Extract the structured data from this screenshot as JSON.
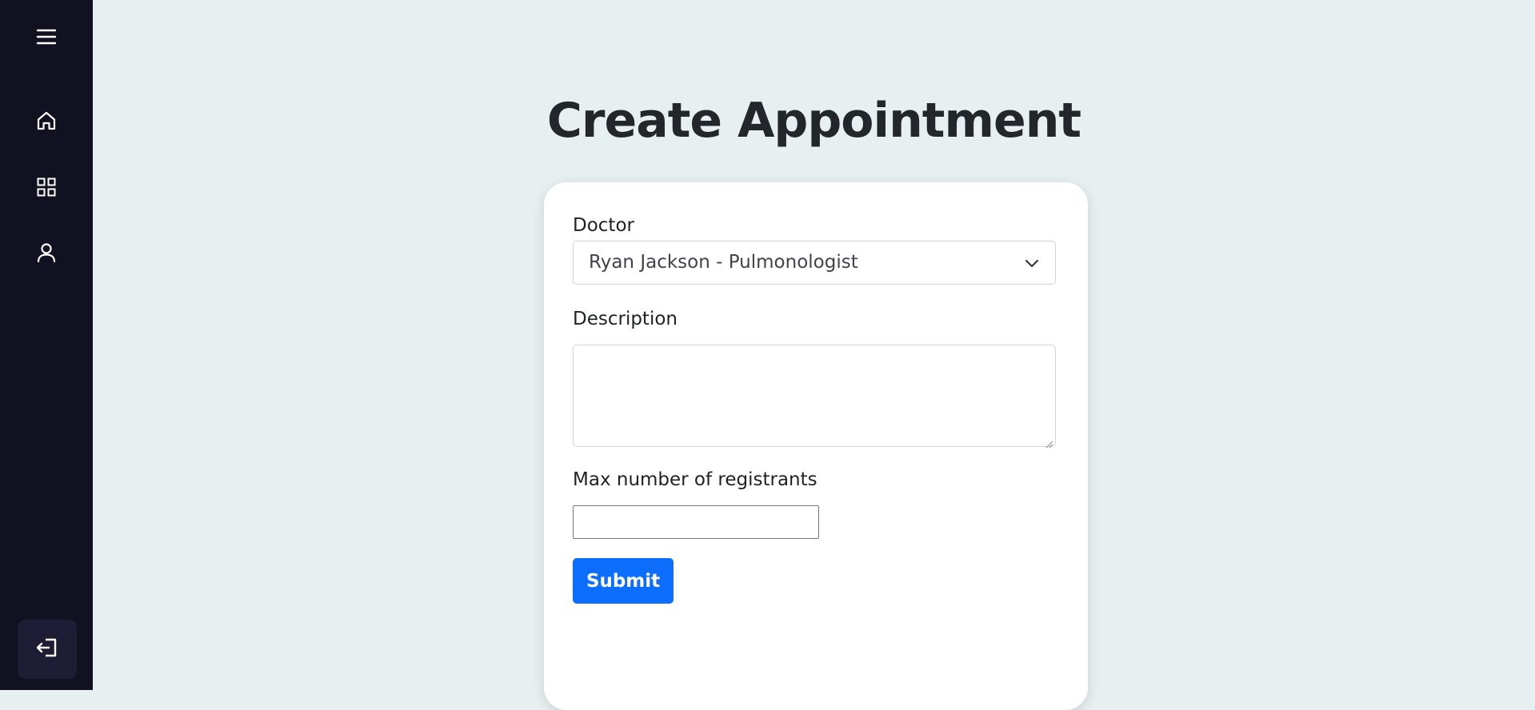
{
  "sidebar": {
    "items": [
      {
        "icon": "menu-icon"
      },
      {
        "icon": "home-icon"
      },
      {
        "icon": "grid-icon"
      },
      {
        "icon": "user-icon"
      }
    ],
    "logout": {
      "icon": "logout-icon"
    }
  },
  "main": {
    "title": "Create Appointment"
  },
  "form": {
    "doctor_label": "Doctor",
    "doctor_value": "Ryan Jackson - Pulmonologist",
    "description_label": "Description",
    "description_value": "",
    "max_label": "Max number of registrants",
    "max_value": "",
    "submit_label": "Submit"
  },
  "colors": {
    "sidebar_bg": "#111122",
    "page_bg": "#e7eff1",
    "accent": "#0d6efd"
  }
}
